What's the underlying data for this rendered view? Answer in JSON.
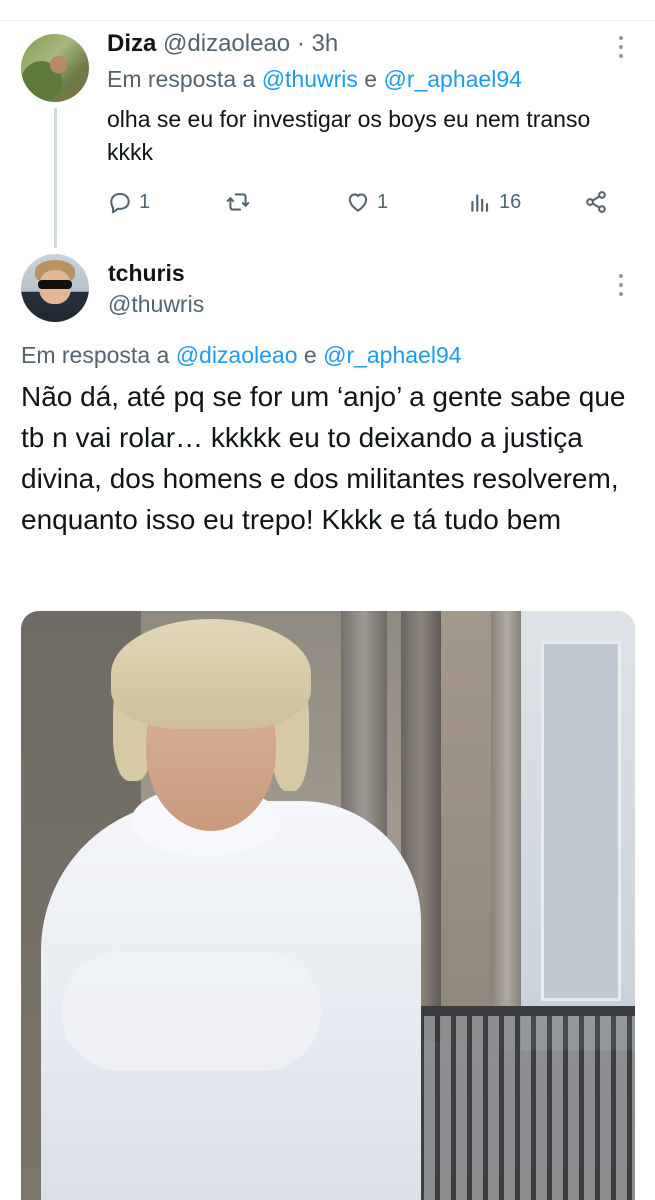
{
  "reply_tweet": {
    "display_name": "Diza",
    "handle": "@dizaoleao",
    "separator": "·",
    "time": "3h",
    "reply_prefix": "Em resposta a",
    "reply_mentions": [
      "@thuwris",
      "@r_aphael94"
    ],
    "reply_joiner": "e",
    "text": "olha se eu for investigar os boys eu nem transo kkkk",
    "actions": {
      "replies": "1",
      "retweets": "",
      "likes": "1",
      "views": "16"
    }
  },
  "main_tweet": {
    "display_name": "tchuris",
    "handle": "@thuwris",
    "reply_prefix": "Em resposta a",
    "reply_mentions": [
      "@dizaoleao",
      "@r_aphael94"
    ],
    "reply_joiner": "e",
    "text": "Não dá, até pq se for um ‘anjo’ a gente sabe que tb n vai rolar… kkkkk eu to deixando a justiça divina, dos homens e dos militantes resolverem, enquanto isso eu trepo! Kkkk e tá tudo bem"
  },
  "colors": {
    "text_primary": "#0f1419",
    "text_secondary": "#536471",
    "accent": "#1d9bf0",
    "thread_line": "#cfd9de"
  },
  "icons": [
    "more-icon",
    "reply-icon",
    "retweet-icon",
    "like-icon",
    "views-icon",
    "share-icon"
  ]
}
